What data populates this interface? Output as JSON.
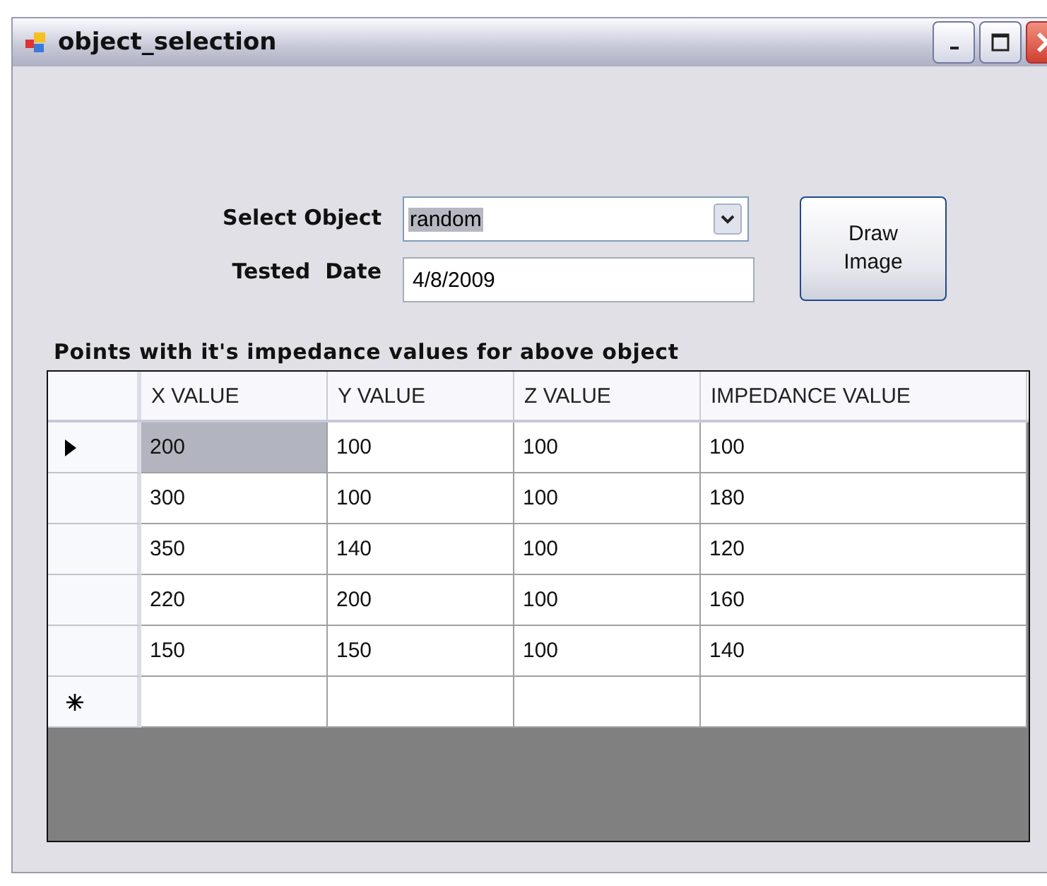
{
  "window": {
    "title": "object_selection"
  },
  "form": {
    "object_label": "Select Object",
    "object_value": "random",
    "date_label": "Tested  Date",
    "date_value": "4/8/2009",
    "draw_button": "Draw\nImage"
  },
  "grid": {
    "caption": "Points with it's impedance values for above object",
    "columns": [
      "X VALUE",
      "Y VALUE",
      "Z VALUE",
      "IMPEDANCE VALUE"
    ],
    "rows": [
      {
        "kind": "data",
        "current": true,
        "cells": [
          {
            "text": "200",
            "selected": true
          },
          {
            "text": "100",
            "selected": false
          },
          {
            "text": "100",
            "selected": false
          },
          {
            "text": "100",
            "selected": false
          }
        ]
      },
      {
        "kind": "data",
        "current": false,
        "cells": [
          {
            "text": "300",
            "selected": false
          },
          {
            "text": "100",
            "selected": false
          },
          {
            "text": "100",
            "selected": false
          },
          {
            "text": "180",
            "selected": false
          }
        ]
      },
      {
        "kind": "data",
        "current": false,
        "cells": [
          {
            "text": "350",
            "selected": false
          },
          {
            "text": "140",
            "selected": false
          },
          {
            "text": "100",
            "selected": false
          },
          {
            "text": "120",
            "selected": false
          }
        ]
      },
      {
        "kind": "data",
        "current": false,
        "cells": [
          {
            "text": "220",
            "selected": false
          },
          {
            "text": "200",
            "selected": false
          },
          {
            "text": "100",
            "selected": false
          },
          {
            "text": "160",
            "selected": false
          }
        ]
      },
      {
        "kind": "data",
        "current": false,
        "cells": [
          {
            "text": "150",
            "selected": false
          },
          {
            "text": "150",
            "selected": false
          },
          {
            "text": "100",
            "selected": false
          },
          {
            "text": "140",
            "selected": false
          }
        ]
      },
      {
        "kind": "new",
        "cells": [
          {
            "text": "",
            "selected": false
          },
          {
            "text": "",
            "selected": false
          },
          {
            "text": "",
            "selected": false
          },
          {
            "text": "",
            "selected": false
          }
        ]
      }
    ]
  }
}
